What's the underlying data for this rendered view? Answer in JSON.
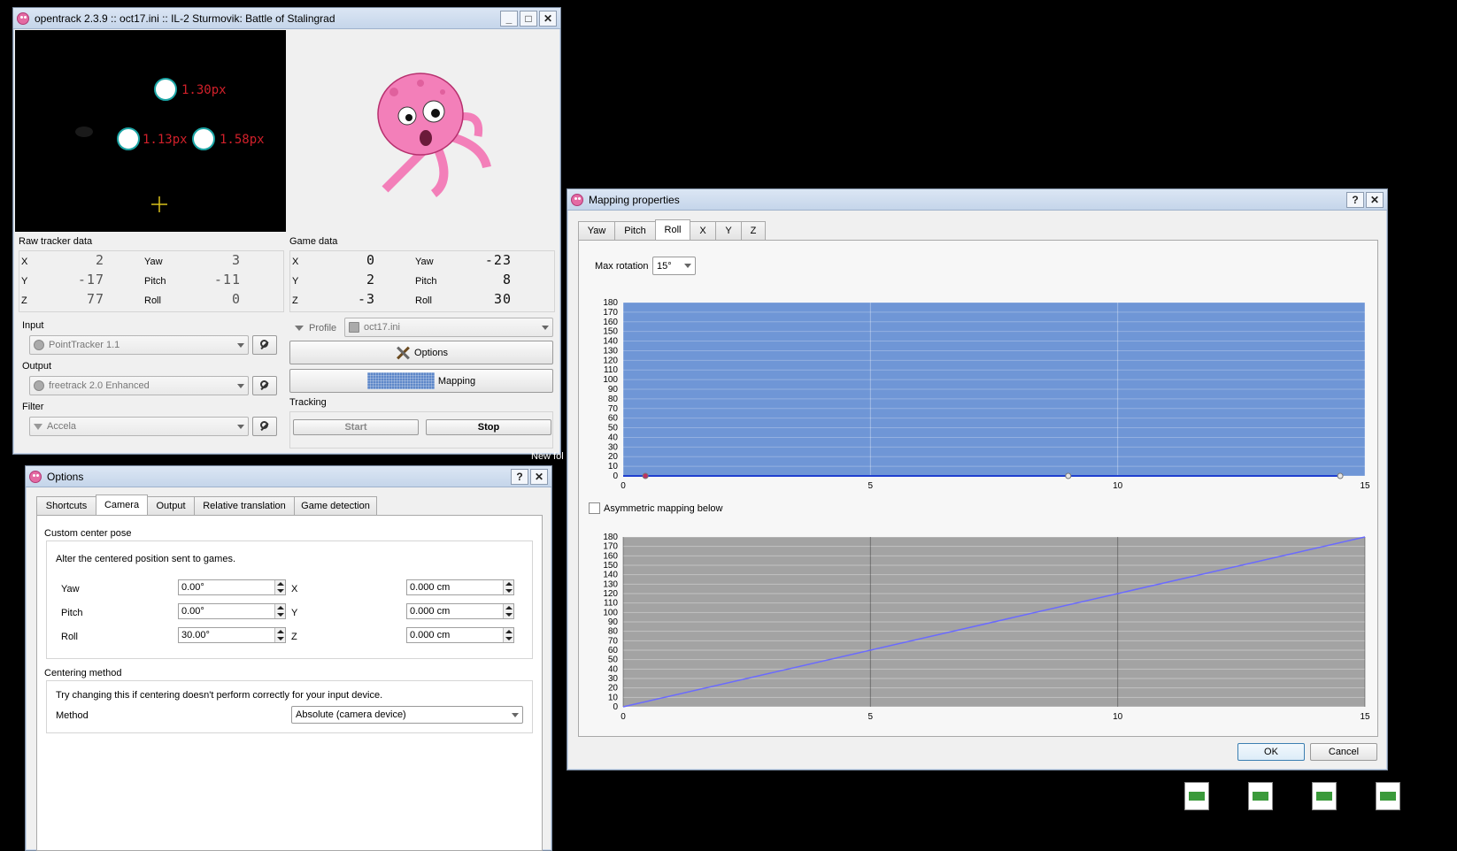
{
  "main_window": {
    "title": "opentrack 2.3.9 :: oct17.ini :: IL-2 Sturmovik: Battle of Stalingrad",
    "preview": {
      "point_labels": [
        "1.30px",
        "1.13px",
        "1.58px"
      ]
    },
    "raw_tracker": {
      "title": "Raw tracker data",
      "rows": [
        {
          "a_label": "X",
          "a_value": "2",
          "b_label": "Yaw",
          "b_value": "3"
        },
        {
          "a_label": "Y",
          "a_value": "-17",
          "b_label": "Pitch",
          "b_value": "-11"
        },
        {
          "a_label": "Z",
          "a_value": "77",
          "b_label": "Roll",
          "b_value": "0"
        }
      ]
    },
    "game_data": {
      "title": "Game data",
      "rows": [
        {
          "a_label": "X",
          "a_value": "0",
          "b_label": "Yaw",
          "b_value": "-23"
        },
        {
          "a_label": "Y",
          "a_value": "2",
          "b_label": "Pitch",
          "b_value": "8"
        },
        {
          "a_label": "Z",
          "a_value": "-3",
          "b_label": "Roll",
          "b_value": "30"
        }
      ]
    },
    "input_label": "Input",
    "input_value": "PointTracker 1.1",
    "output_label": "Output",
    "output_value": "freetrack 2.0 Enhanced",
    "filter_label": "Filter",
    "filter_value": "Accela",
    "profile_label": "Profile",
    "profile_value": "oct17.ini",
    "options_button": "Options",
    "mapping_button": "Mapping",
    "tracking_label": "Tracking",
    "start_button": "Start",
    "stop_button": "Stop"
  },
  "options_window": {
    "title": "Options",
    "help": "?",
    "close": "✕",
    "tabs": [
      "Shortcuts",
      "Camera",
      "Output",
      "Relative translation",
      "Game detection"
    ],
    "active_tab": "Camera",
    "center_group_title": "Custom center pose",
    "center_desc": "Alter the centered position sent to games.",
    "rows": [
      {
        "label": "Yaw",
        "value": "0.00°",
        "axis": "X",
        "axis_value": "0.000 cm"
      },
      {
        "label": "Pitch",
        "value": "0.00°",
        "axis": "Y",
        "axis_value": "0.000 cm"
      },
      {
        "label": "Roll",
        "value": "30.00°",
        "axis": "Z",
        "axis_value": "0.000 cm"
      }
    ],
    "centering_title": "Centering method",
    "centering_desc": "Try changing this if centering doesn't perform correctly for your input device.",
    "method_label": "Method",
    "method_value": "Absolute (camera device)"
  },
  "mapping_window": {
    "title": "Mapping properties",
    "help": "?",
    "close": "✕",
    "tabs": [
      "Yaw",
      "Pitch",
      "Roll",
      "X",
      "Y",
      "Z"
    ],
    "active_tab": "Roll",
    "max_rotation_label": "Max rotation",
    "max_rotation_value": "15°",
    "asymmetric_label": "Asymmetric mapping below",
    "ok_button": "OK",
    "cancel_button": "Cancel"
  },
  "desktop": {
    "fragment_text": "New fol"
  },
  "colors": {
    "accent": "#3a7bd5",
    "curve_main": "#1f3fd0",
    "curve_asym": "#6a6aff",
    "preview_label": "#d0202a"
  },
  "chart_data": [
    {
      "type": "line",
      "title": "",
      "x_ticks": [
        0,
        5,
        10,
        15
      ],
      "y_ticks": [
        0,
        10,
        20,
        30,
        40,
        50,
        60,
        70,
        80,
        90,
        100,
        110,
        120,
        130,
        140,
        150,
        160,
        170,
        180
      ],
      "xlim": [
        0,
        15
      ],
      "ylim": [
        0,
        180
      ],
      "series": [
        {
          "x": [
            0,
            0.45,
            9,
            14.5
          ],
          "y": [
            0,
            0,
            0,
            0
          ]
        }
      ],
      "control_points": [
        {
          "x": 0.45,
          "y": 0
        },
        {
          "x": 9,
          "y": 0
        },
        {
          "x": 14.5,
          "y": 0
        }
      ],
      "grid": true
    },
    {
      "type": "line",
      "title": "",
      "x_ticks": [
        0,
        5,
        10,
        15
      ],
      "y_ticks": [
        0,
        10,
        20,
        30,
        40,
        50,
        60,
        70,
        80,
        90,
        100,
        110,
        120,
        130,
        140,
        150,
        160,
        170,
        180
      ],
      "xlim": [
        0,
        15
      ],
      "ylim": [
        0,
        180
      ],
      "series": [
        {
          "x": [
            0,
            15
          ],
          "y": [
            0,
            180
          ]
        }
      ],
      "grid": true
    }
  ]
}
